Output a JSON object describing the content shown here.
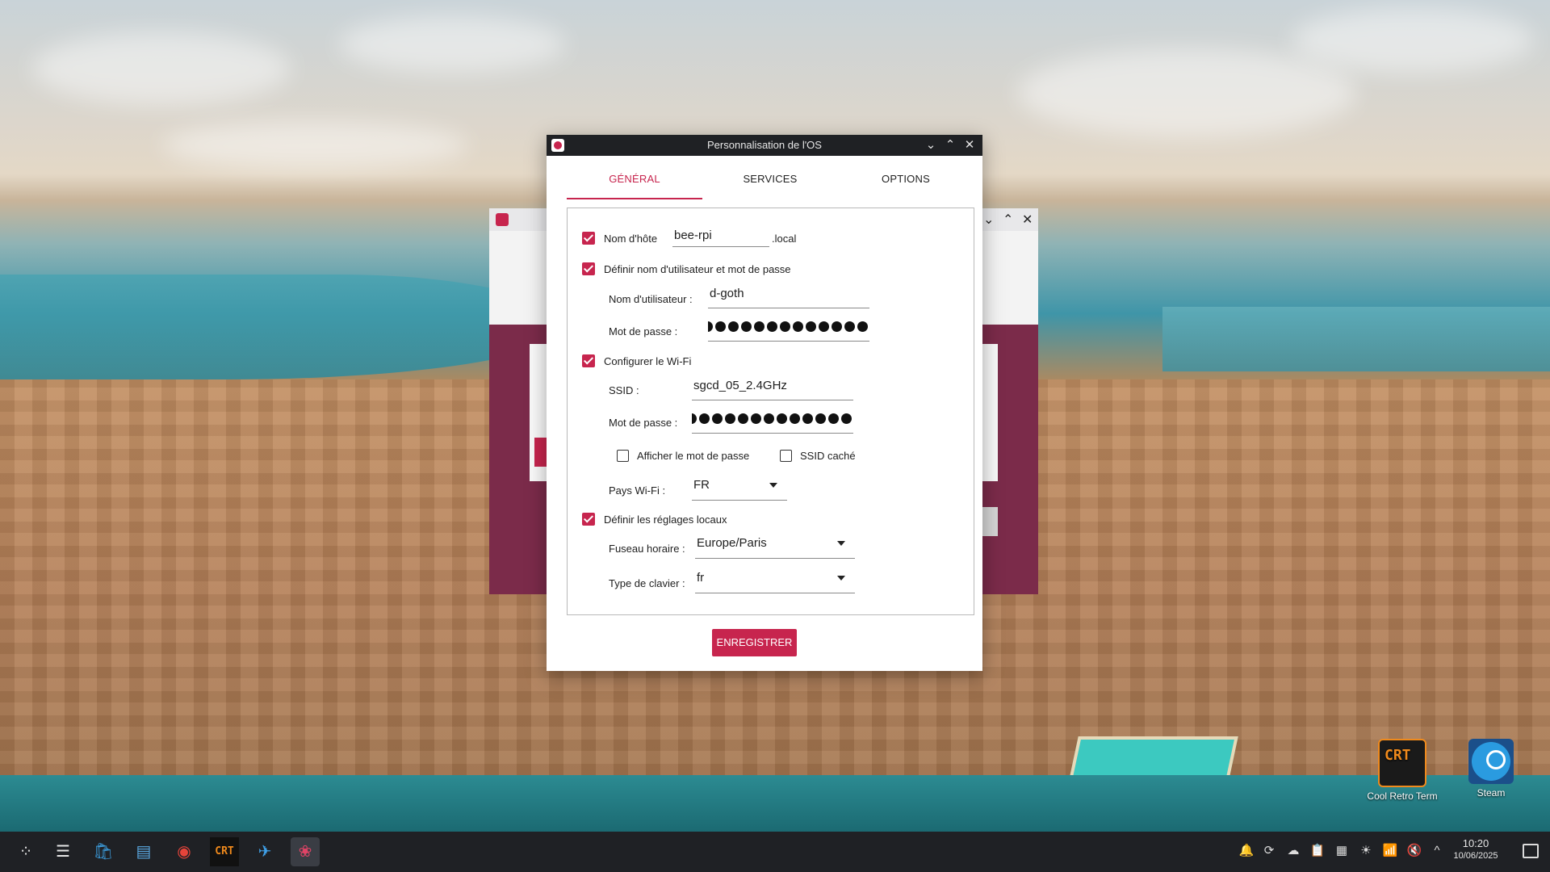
{
  "dialog": {
    "title": "Personnalisation de l'OS",
    "tabs": [
      {
        "label": "GÉNÉRAL",
        "active": true
      },
      {
        "label": "SERVICES",
        "active": false
      },
      {
        "label": "OPTIONS",
        "active": false
      }
    ],
    "hostname": {
      "checked": true,
      "label": "Nom d'hôte",
      "value": "bee-rpi",
      "suffix": ".local"
    },
    "user": {
      "checked": true,
      "label": "Définir nom d'utilisateur et mot de passe",
      "username_label": "Nom d'utilisateur :",
      "username_value": "d-goth",
      "password_label": "Mot de passe :"
    },
    "wifi": {
      "checked": true,
      "label": "Configurer le Wi-Fi",
      "ssid_label": "SSID :",
      "ssid_value": "sgcd_05_2.4GHz",
      "password_label": "Mot de passe :",
      "show_password": {
        "checked": false,
        "label": "Afficher le mot de passe"
      },
      "hidden_ssid": {
        "checked": false,
        "label": "SSID caché"
      },
      "country_label": "Pays Wi-Fi :",
      "country_value": "FR"
    },
    "locale": {
      "checked": true,
      "label": "Définir les réglages locaux",
      "timezone_label": "Fuseau horaire :",
      "timezone_value": "Europe/Paris",
      "keyboard_label": "Type de clavier :",
      "keyboard_value": "fr"
    },
    "save_label": "ENREGISTRER"
  },
  "desktop_icons": [
    {
      "label": "Cool Retro Term",
      "glyph": "CRT"
    },
    {
      "label": "Steam"
    }
  ],
  "taskbar": {
    "apps": [
      {
        "name": "app-launcher-icon",
        "glyph": "⁘"
      },
      {
        "name": "settings-sliders-icon",
        "glyph": "☰"
      },
      {
        "name": "software-store-icon",
        "glyph": "🛍"
      },
      {
        "name": "file-manager-icon",
        "glyph": "▤"
      },
      {
        "name": "chrome-icon",
        "glyph": "◉"
      },
      {
        "name": "cool-retro-term-icon",
        "glyph": "CRT"
      },
      {
        "name": "browser-icon",
        "glyph": "✈"
      },
      {
        "name": "raspberry-pi-imager-icon",
        "glyph": "❀"
      }
    ],
    "tray": [
      "bell-icon",
      "sync-icon",
      "cloud-icon",
      "clipboard-icon",
      "storage-icon",
      "brightness-icon",
      "wifi-icon",
      "volume-muted-icon",
      "chevron-up-icon"
    ],
    "tray_glyphs": [
      "🔔",
      "⟳",
      "☁",
      "📋",
      "▦",
      "☀",
      "📶",
      "🔇",
      "^"
    ],
    "time": "10:20",
    "date": "10/06/2025"
  },
  "colors": {
    "accent": "#c7254e",
    "titlebar": "#1f2124",
    "taskbar": "#1f2125"
  }
}
